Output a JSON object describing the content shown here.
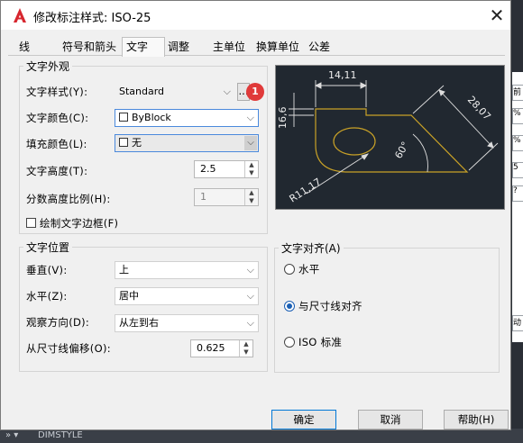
{
  "window": {
    "title": "修改标注样式: ISO-25"
  },
  "tabs": [
    {
      "label": "线"
    },
    {
      "label": "符号和箭头"
    },
    {
      "label": "文字"
    },
    {
      "label": "调整"
    },
    {
      "label": "主单位"
    },
    {
      "label": "换算单位"
    },
    {
      "label": "公差"
    }
  ],
  "active_tab": "文字",
  "text_appearance": {
    "group_title": "文字外观",
    "style_label": "文字样式(Y):",
    "style_value": "Standard",
    "style_browse": "...",
    "color_label": "文字颜色(C):",
    "color_value": "ByBlock",
    "fill_label": "填充颜色(L):",
    "fill_value": "无",
    "height_label": "文字高度(T):",
    "height_value": "2.5",
    "fraction_label": "分数高度比例(H):",
    "fraction_value": "1",
    "frame_label": "绘制文字边框(F)",
    "frame_checked": false
  },
  "annotation_badge": "1",
  "text_placement": {
    "group_title": "文字位置",
    "vertical_label": "垂直(V):",
    "vertical_value": "上",
    "horizontal_label": "水平(Z):",
    "horizontal_value": "居中",
    "view_label": "观察方向(D):",
    "view_value": "从左到右",
    "offset_label": "从尺寸线偏移(O):",
    "offset_value": "0.625"
  },
  "text_alignment": {
    "group_title": "文字对齐(A)",
    "options": [
      "水平",
      "与尺寸线对齐",
      "ISO 标准"
    ],
    "selected": "与尺寸线对齐"
  },
  "preview": {
    "dim_top": "14,11",
    "dim_left": "16,6",
    "dim_right": "28,07",
    "dim_angle": "60°",
    "dim_radius": "R11,17"
  },
  "buttons": {
    "ok": "确定",
    "cancel": "取消",
    "help": "帮助(H)"
  },
  "background": {
    "command_line": "DIMSTYLE"
  },
  "colors": {
    "accent": "#1a5fb4",
    "badge": "#e03a3a",
    "preview_bg": "#212830",
    "preview_lines": "#c9a227"
  }
}
